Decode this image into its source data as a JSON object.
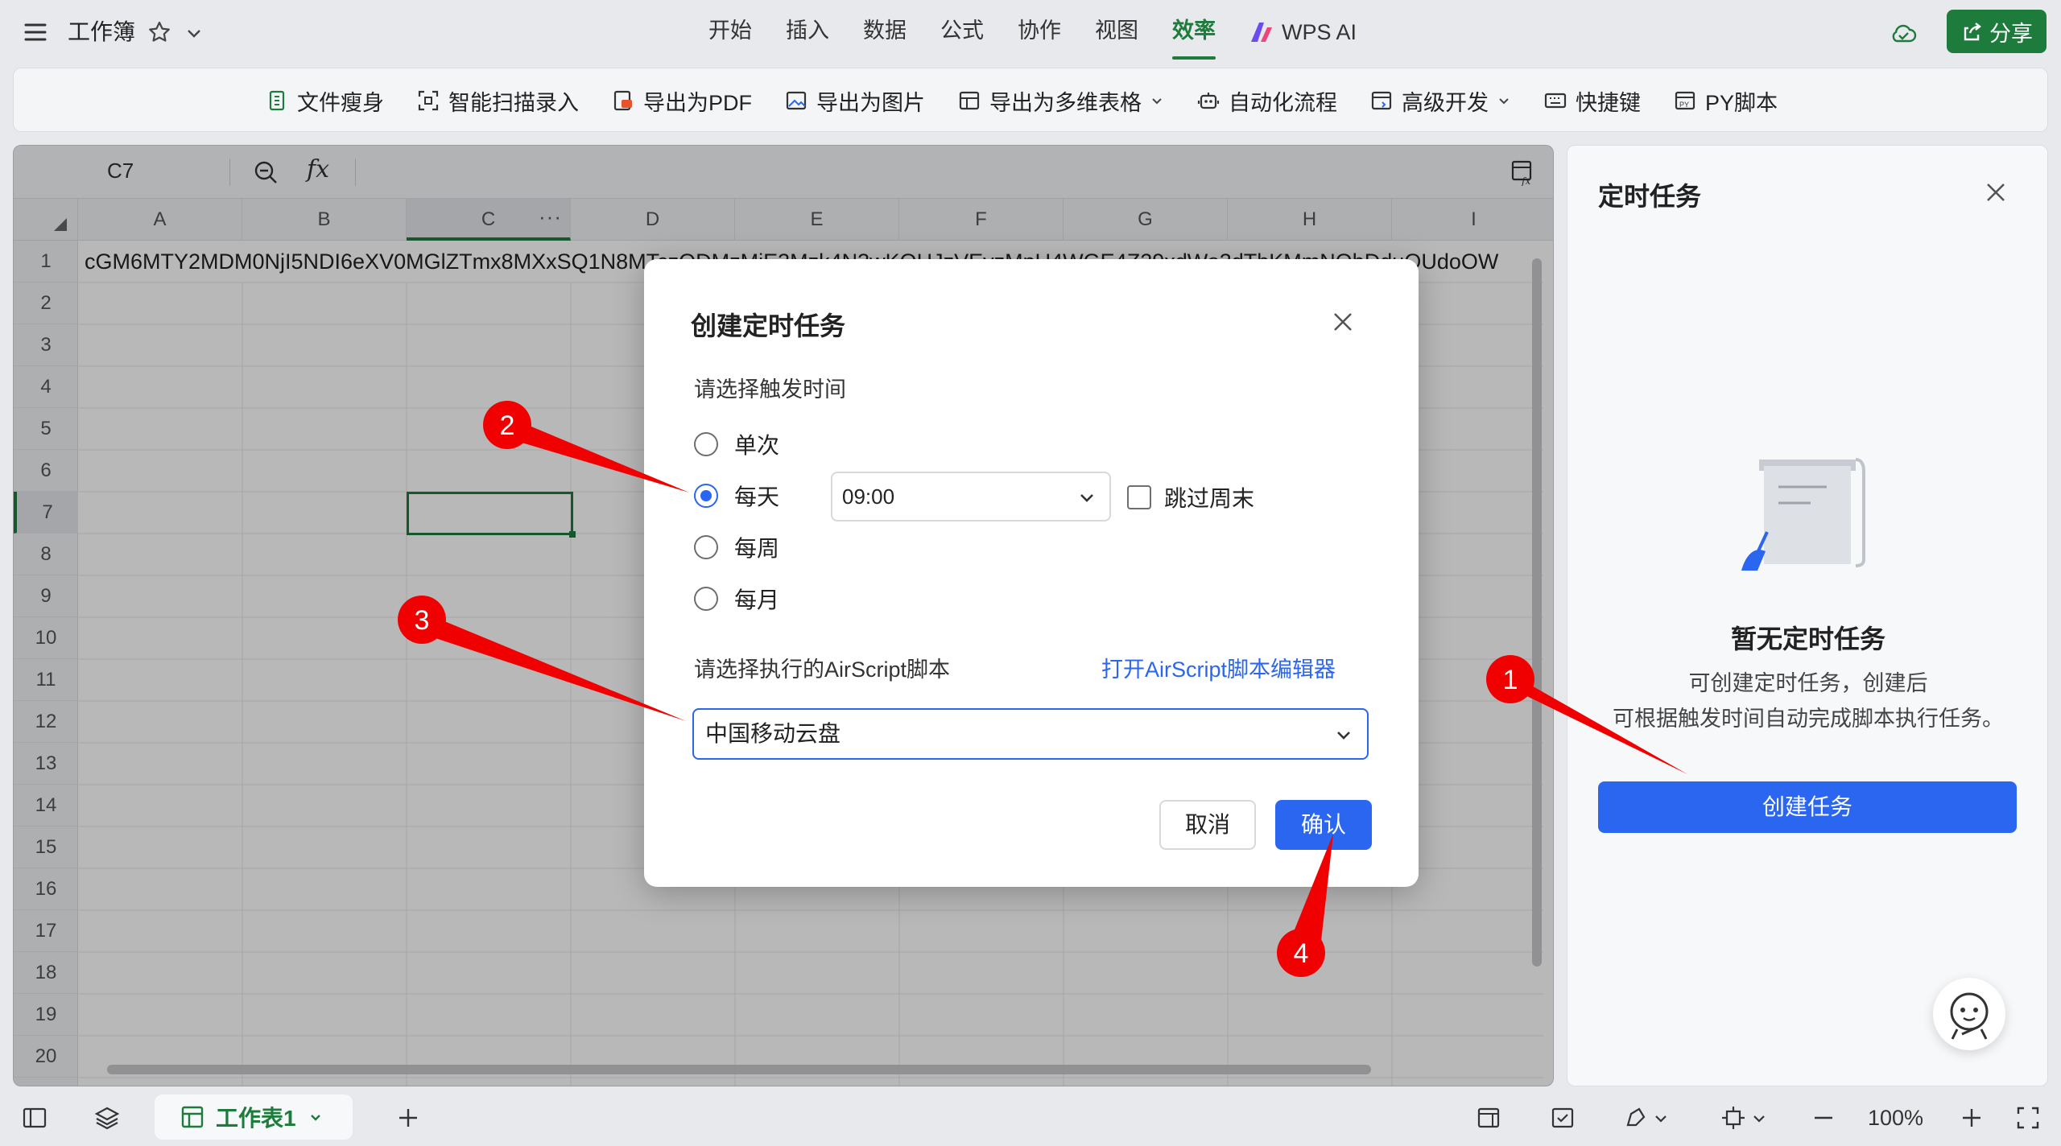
{
  "window": {
    "doc_title": "工作簿",
    "tabs": [
      "开始",
      "插入",
      "数据",
      "公式",
      "协作",
      "视图",
      "效率"
    ],
    "active_tab": "效率",
    "ai_tab": "WPS AI",
    "share_label": "分享"
  },
  "ribbon": {
    "items": [
      "文件瘦身",
      "智能扫描录入",
      "导出为PDF",
      "导出为图片",
      "导出为多维表格",
      "自动化流程",
      "高级开发",
      "快捷键",
      "PY脚本"
    ]
  },
  "formula_bar": {
    "cell_ref": "C7",
    "fx_label": "fx"
  },
  "sheet": {
    "columns": [
      "A",
      "B",
      "C",
      "D",
      "E",
      "F",
      "G",
      "H",
      "I"
    ],
    "rows": [
      "1",
      "2",
      "3",
      "4",
      "5",
      "6",
      "7",
      "8",
      "9",
      "10",
      "11",
      "12",
      "13",
      "14",
      "15",
      "16",
      "17",
      "18",
      "19",
      "20"
    ],
    "selected_column": "C",
    "selected_row": "7",
    "a1_value": "cGM6MTY2MDM0NjI5NDI6eXV0MGlZTmx8MXxSQ1N8MTczODMzMjE3Mzk4N3wKQHJzVEvzMpU4WGE4Z29xdWo3dThKMmNQbDduOUdoOW"
  },
  "dialog": {
    "title": "创建定时任务",
    "trigger_label": "请选择触发时间",
    "options": [
      "单次",
      "每天",
      "每周",
      "每月"
    ],
    "selected_option": "每天",
    "time_value": "09:00",
    "skip_weekend_label": "跳过周末",
    "script_label": "请选择执行的AirScript脚本",
    "open_editor_link": "打开AirScript脚本编辑器",
    "script_value": "中国移动云盘",
    "cancel_label": "取消",
    "ok_label": "确认"
  },
  "panel": {
    "title": "定时任务",
    "empty_title": "暂无定时任务",
    "empty_desc_line1": "可创建定时任务，创建后",
    "empty_desc_line2": "可根据触发时间自动完成脚本执行任务。",
    "create_label": "创建任务"
  },
  "bottom": {
    "sheet_tab": "工作表1",
    "zoom": "100%"
  },
  "annotations": [
    "1",
    "2",
    "3",
    "4"
  ],
  "colors": {
    "accent_green": "#1d7b3c",
    "accent_blue": "#2a66f0",
    "annotation_red": "#f00000"
  }
}
